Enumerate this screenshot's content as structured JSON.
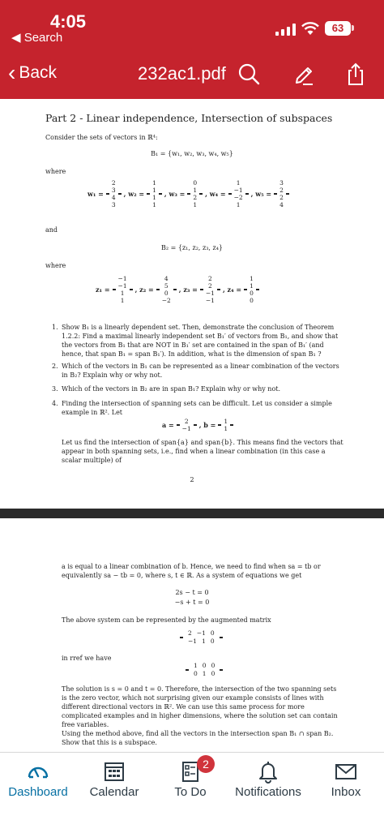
{
  "status": {
    "time": "4:05",
    "back_app": "◀ Search",
    "battery": "63"
  },
  "nav": {
    "back_label": "Back",
    "title": "232ac1.pdf"
  },
  "page1": {
    "heading": "Part 2 - Linear independence, Intersection of subspaces",
    "intro": "Consider the sets of vectors in ℝ⁴:",
    "b1_def": "B₁ = {w₁, w₂, w₃, w₄, w₅}",
    "where1": "where",
    "w_labels": [
      "w₁ =",
      ", w₂ =",
      ", w₃ =",
      ", w₄ =",
      ", w₅ ="
    ],
    "w_vectors": [
      [
        "2",
        "3",
        "4",
        "3"
      ],
      [
        "1",
        "1",
        "1",
        "1"
      ],
      [
        "0",
        "1",
        "2",
        "1"
      ],
      [
        "1",
        "−1",
        "−2",
        "1"
      ],
      [
        "3",
        "2",
        "2",
        "4"
      ]
    ],
    "and": "and",
    "b2_def": "B₂ = {z₁, z₂, z₃, z₄}",
    "where2": "where",
    "z_labels": [
      "z₁ =",
      ",   z₂ =",
      ",   z₃ =",
      ",   z₄ ="
    ],
    "z_vectors": [
      [
        "−1",
        "−1",
        "1",
        "1"
      ],
      [
        "4",
        "5",
        "0",
        "−2"
      ],
      [
        "2",
        "2",
        "−1",
        "−1"
      ],
      [
        "1",
        "1",
        "0",
        "0"
      ]
    ],
    "q1_num": "1.",
    "q1": "Show B₁ is a linearly dependent set. Then, demonstrate the conclusion of Theorem 1.2.2: Find a maximal linearly independent set B₁′ of vectors from B₁, and show that the vectors from B₁ that are NOT in B₁′ set are contained in the span of B₁′ (and hence, that span B₁ = span B₁′). In addition, what is the dimension of span B₁ ?",
    "q2_num": "2.",
    "q2": "Which of the vectors in B₁ can be represented as a linear combination of the vectors in B₂? Explain why or why not.",
    "q3_num": "3.",
    "q3": "Which of the vectors in B₂ are in span B₁? Explain why or why not.",
    "q4_num": "4.",
    "q4": "Finding the intersection of spanning sets can be difficult. Let us consider a simple example in ℝ². Let",
    "a_label": "a =",
    "a_vec": [
      "2",
      "−1"
    ],
    "b_label": ",    b =",
    "b_vec": [
      "1",
      "1"
    ],
    "q4_cont": "Let us find the intersection of span{a} and span{b}. This means find the vectors that appear in both spanning sets, i.e., find when a linear combination (in this case a scalar multiple) of",
    "page_number": "2"
  },
  "page2": {
    "p1": "a is equal to a linear combination of b. Hence, we need to find when sa = tb or equivalently sa − tb = 0, where s, t ∈ ℝ. As a system of equations we get",
    "eq1": "2s − t = 0",
    "eq2": "−s + t = 0",
    "p2": "The above system can be represented by the augmented matrix",
    "aug_rows": [
      [
        "2",
        "−1",
        "0"
      ],
      [
        "−1",
        "1",
        "0"
      ]
    ],
    "p3": "in rref we have",
    "rref_rows": [
      [
        "1",
        "0",
        "0"
      ],
      [
        "0",
        "1",
        "0"
      ]
    ],
    "p4": "The solution is s = 0 and t = 0. Therefore, the intersection of the two spanning sets is the zero vector, which not surprising given our example consists of lines with different directional vectors in ℝ². We can use this same process for more complicated examples and in higher dimensions, where the solution set can contain free variables.",
    "p5": "Using the method above, find all the vectors in the intersection span B₁ ∩ span B₂. Show that this is a subspace."
  },
  "tabs": [
    {
      "label": "Dashboard",
      "icon": "dashboard-icon",
      "active": true
    },
    {
      "label": "Calendar",
      "icon": "calendar-icon"
    },
    {
      "label": "To Do",
      "icon": "todo-icon",
      "badge": "2"
    },
    {
      "label": "Notifications",
      "icon": "bell-icon"
    },
    {
      "label": "Inbox",
      "icon": "mail-icon"
    }
  ],
  "colors": {
    "header": "#c5232d",
    "active_tab": "#0770a3",
    "badge": "#d0343c"
  }
}
